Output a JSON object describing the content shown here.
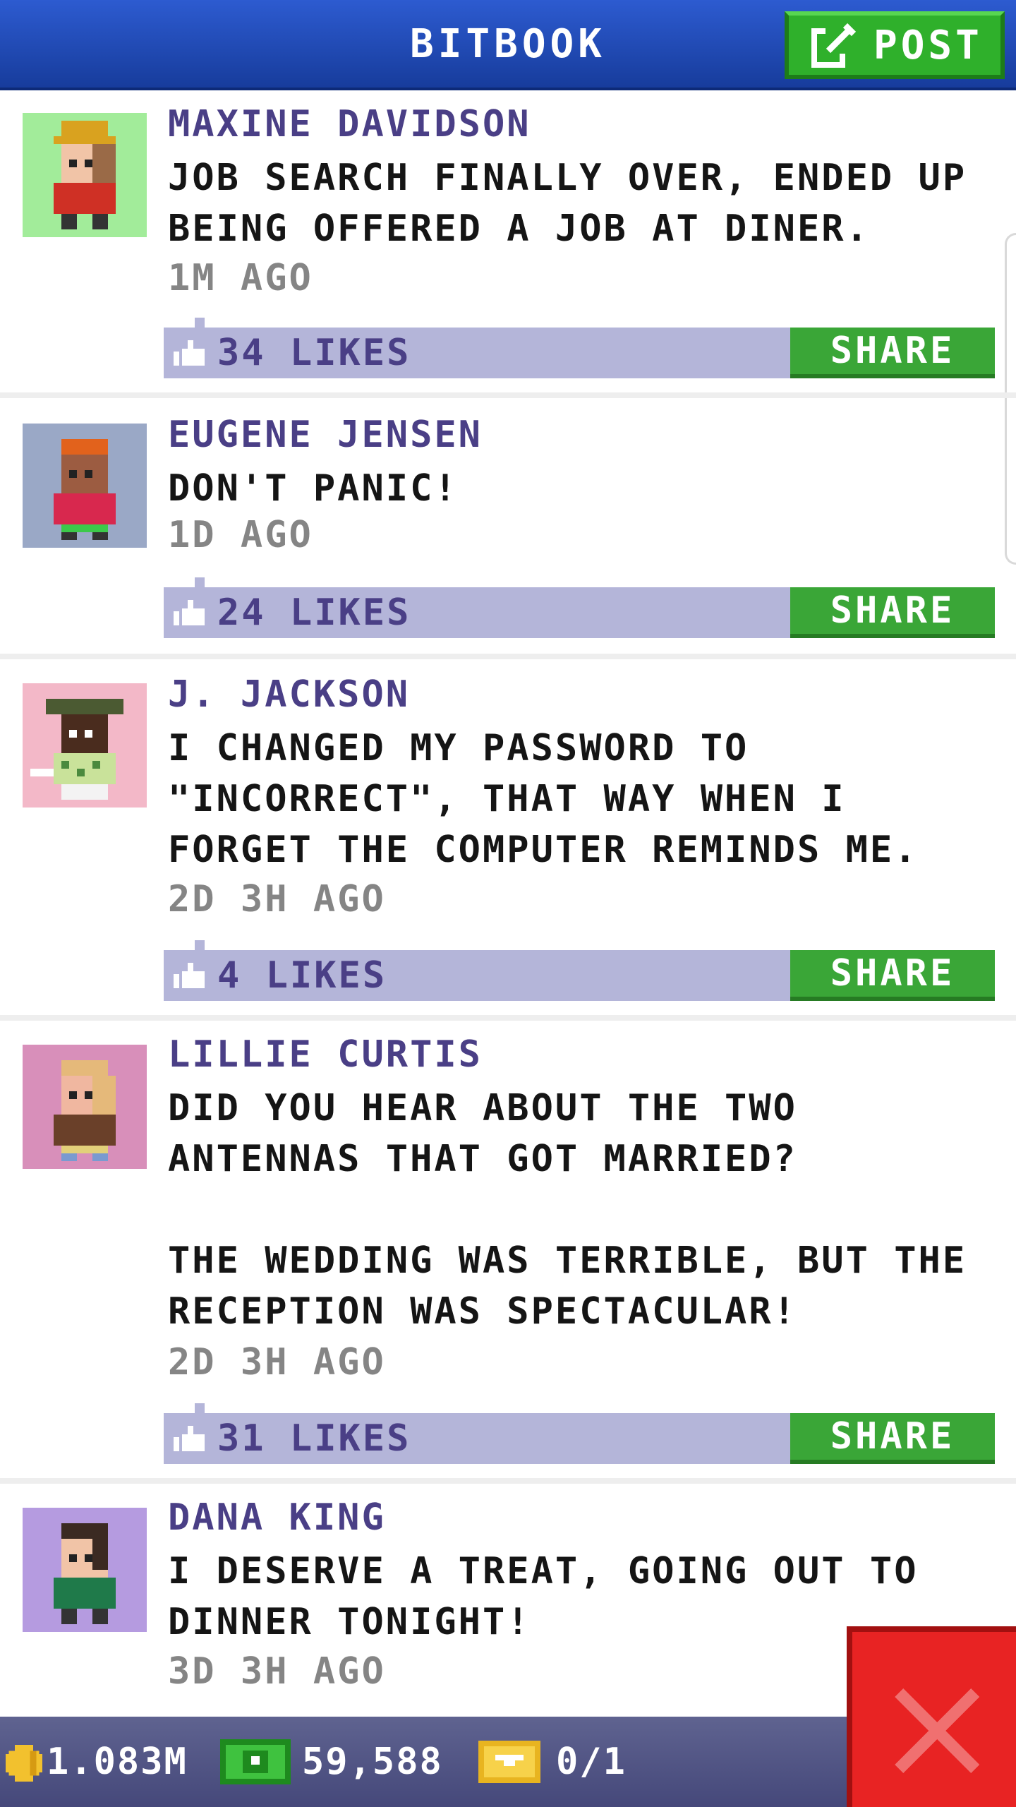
{
  "app": {
    "title": "BITBOOK",
    "post_label": "POST"
  },
  "posts": [
    {
      "author": "MAXINE DAVIDSON",
      "message": "JOB SEARCH FINALLY OVER, ENDED UP BEING OFFERED A JOB AT DINER.",
      "time": "1M AGO",
      "likes": "34 LIKES",
      "share_label": "SHARE",
      "avatar_bg": "#a2ec9a"
    },
    {
      "author": "EUGENE JENSEN",
      "message": "DON'T PANIC!",
      "time": "1D AGO",
      "likes": "24 LIKES",
      "share_label": "SHARE",
      "avatar_bg": "#9aa8c6"
    },
    {
      "author": "J. JACKSON",
      "message": "I CHANGED MY PASSWORD TO \"INCORRECT\", THAT WAY WHEN I FORGET THE COMPUTER REMINDS ME.",
      "time": "2D 3H AGO",
      "likes": "4 LIKES",
      "share_label": "SHARE",
      "avatar_bg": "#f3b8c8"
    },
    {
      "author": "LILLIE CURTIS",
      "message": "DID YOU HEAR ABOUT THE TWO ANTENNAS THAT GOT MARRIED?\n\nTHE WEDDING WAS TERRIBLE, BUT THE RECEPTION WAS SPECTACULAR!",
      "time": "2D 3H AGO",
      "likes": "31 LIKES",
      "share_label": "SHARE",
      "avatar_bg": "#d88fba"
    },
    {
      "author": "DANA KING",
      "message": "I DESERVE A TREAT, GOING OUT TO DINNER TONIGHT!",
      "time": "3D 3H AGO",
      "avatar_bg": "#b59be0"
    }
  ],
  "status": {
    "coins": "1.083M",
    "cash": "59,588",
    "tickets": "0/1"
  },
  "icons": {
    "post": "edit-icon",
    "like": "thumbs-up-icon",
    "coin": "coin-icon",
    "cash": "cash-icon",
    "ticket": "ticket-icon",
    "close": "close-icon"
  },
  "colors": {
    "header": "#1f47b4",
    "button_green": "#3aa637",
    "like_bar": "#b4b5d9",
    "name_text": "#4a3f86",
    "close_red": "#e82323"
  }
}
